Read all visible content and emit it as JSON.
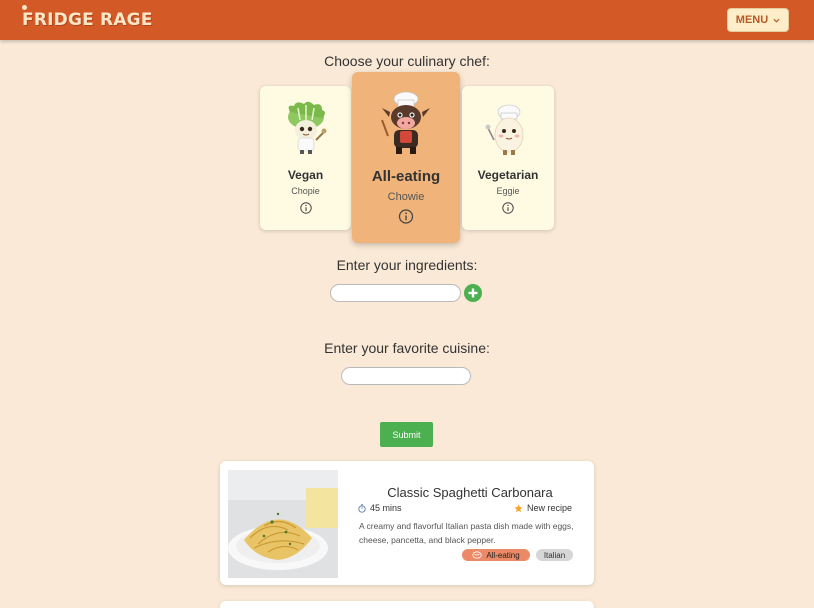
{
  "header": {
    "logo_text": "FRIDGE RAGE",
    "menu_label": "MENU",
    "brand_color": "#d35a26"
  },
  "chef_section": {
    "title": "Choose your culinary chef:",
    "chefs": [
      {
        "name": "Vegan",
        "nickname": "Chopie",
        "selected": false,
        "icon": "leaf-chef"
      },
      {
        "name": "All-eating",
        "nickname": "Chowie",
        "selected": true,
        "icon": "cow-chef"
      },
      {
        "name": "Vegetarian",
        "nickname": "Eggie",
        "selected": false,
        "icon": "egg-chef"
      }
    ]
  },
  "ingredients": {
    "title": "Enter your ingredients:",
    "value": "",
    "placeholder": ""
  },
  "cuisine": {
    "title": "Enter your favorite cuisine:",
    "value": "",
    "placeholder": ""
  },
  "submit_label": "Submit",
  "recipes": [
    {
      "title": "Classic Spaghetti Carbonara",
      "time": "45 mins",
      "badge": "New recipe",
      "description": "A creamy and flavorful Italian pasta dish made with eggs, cheese, pancetta, and black pepper.",
      "tags": [
        "All-eating",
        "Italian"
      ]
    }
  ],
  "colors": {
    "background": "#fae9d6",
    "selected_card": "#f0b47a",
    "card": "#fffbe3",
    "green": "#4caf50",
    "tag_alleating": "#ec8a67",
    "tag_other": "#d6d6d6"
  }
}
